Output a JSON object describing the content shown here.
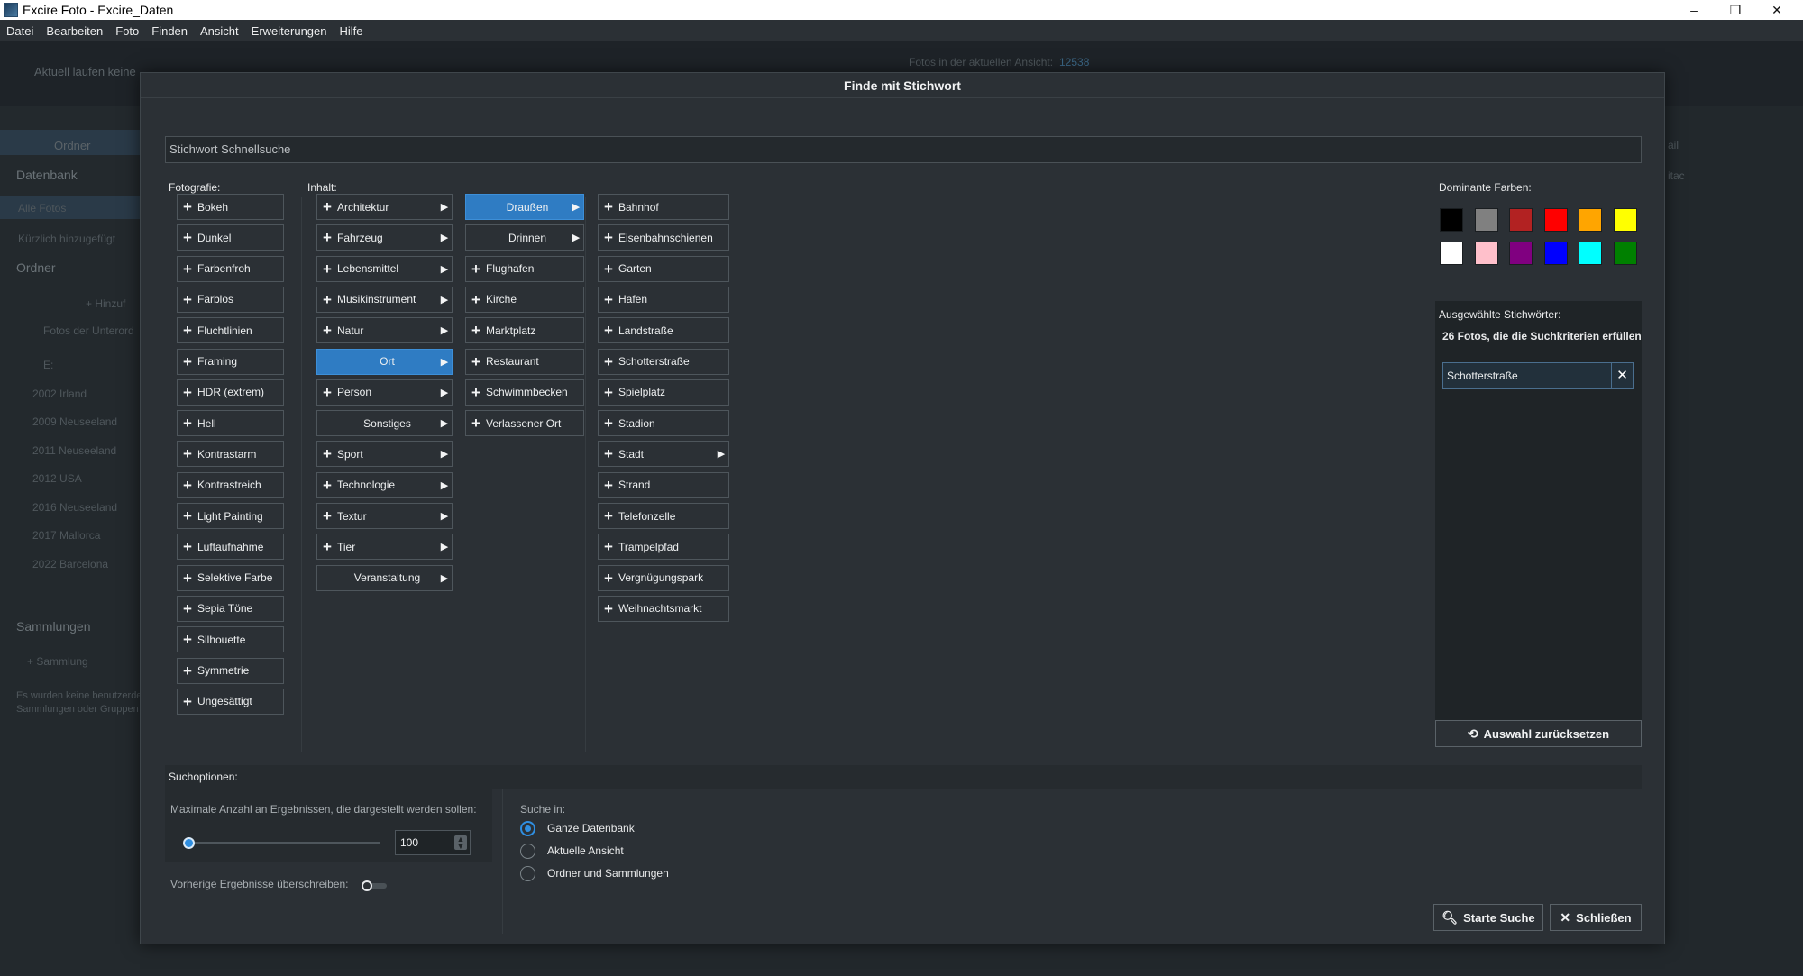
{
  "window": {
    "title": "Excire Foto - Excire_Daten",
    "controls": [
      "–",
      "❐",
      "✕"
    ]
  },
  "menubar": [
    "Datei",
    "Bearbeiten",
    "Foto",
    "Finden",
    "Ansicht",
    "Erweiterungen",
    "Hilfe"
  ],
  "background": {
    "status_text": "Aktuell laufen keine",
    "photos_in_view_label": "Fotos in der aktuellen Ansicht:",
    "photos_in_view_count": "12538",
    "tab_ordner": "Ordner",
    "datenbank_head": "Datenbank",
    "alle_fotos": "Alle Fotos",
    "kuerzlich": "Kürzlich hinzugefügt",
    "ordner_head": "Ordner",
    "hinzu": "+ Hinzuf",
    "unterordner": "Fotos der Unterord",
    "root": "E:",
    "folders": [
      "2002 Irland",
      "2009 Neuseeland",
      "2011 Neuseeland",
      "2012 USA",
      "2016 Neuseeland",
      "2017 Mallorca",
      "2022 Barcelona"
    ],
    "sammlungen_head": "Sammlungen",
    "sammlung_btn": "+ Sammlung",
    "info_line1": "Es wurden keine benutzerdefinierten",
    "info_line2": "Sammlungen oder Gruppen",
    "right_text1": "ail",
    "right_text2": "itac"
  },
  "dialog": {
    "title": "Finde mit Stichwort",
    "quicksearch_placeholder": "Stichwort Schnellsuche",
    "fotografie_label": "Fotografie:",
    "inhalt_label": "Inhalt:",
    "fotografie": [
      "Bokeh",
      "Dunkel",
      "Farbenfroh",
      "Farblos",
      "Fluchtlinien",
      "Framing",
      "HDR (extrem)",
      "Hell",
      "Kontrastarm",
      "Kontrastreich",
      "Light Painting",
      "Luftaufnahme",
      "Selektive Farbe",
      "Sepia Töne",
      "Silhouette",
      "Symmetrie",
      "Ungesättigt"
    ],
    "inhalt": [
      "Architektur",
      "Fahrzeug",
      "Lebensmittel",
      "Musikinstrument",
      "Natur",
      "Ort",
      "Person",
      "Sonstiges",
      "Sport",
      "Technologie",
      "Textur",
      "Tier",
      "Veranstaltung"
    ],
    "ort": [
      "Draußen",
      "Drinnen",
      "Flughafen",
      "Kirche",
      "Marktplatz",
      "Restaurant",
      "Schwimmbecken",
      "Verlassener Ort"
    ],
    "draussen": [
      "Bahnhof",
      "Eisenbahnschienen",
      "Garten",
      "Hafen",
      "Landstraße",
      "Schotterstraße",
      "Spielplatz",
      "Stadion",
      "Stadt",
      "Strand",
      "Telefonzelle",
      "Trampelpfad",
      "Vergnügungspark",
      "Weihnachtsmarkt"
    ],
    "colors_label": "Dominante Farben:",
    "colors": [
      "#000000",
      "#808080",
      "#b22222",
      "#ff0000",
      "#ffa500",
      "#ffff00",
      "#ffffff",
      "#ffc0cb",
      "#800080",
      "#0000ff",
      "#00ffff",
      "#008000"
    ],
    "selected_label": "Ausgewählte Stichwörter:",
    "result_count": "26 Fotos, die die Suchkriterien erfüllen",
    "selected_tag": "Schotterstraße",
    "reset_label": "Auswahl zurücksetzen",
    "options_label": "Suchoptionen:",
    "max_results_label": "Maximale Anzahl an Ergebnissen, die dargestellt werden sollen:",
    "max_results_value": "100",
    "overwrite_label": "Vorherige Ergebnisse überschreiben:",
    "search_in_label": "Suche in:",
    "search_in_options": [
      "Ganze Datenbank",
      "Aktuelle Ansicht",
      "Ordner und Sammlungen"
    ],
    "search_in_selected": "Ganze Datenbank",
    "start_label": "Starte Suche",
    "close_label": "Schließen",
    "accent_color": "#2f7cc3"
  }
}
